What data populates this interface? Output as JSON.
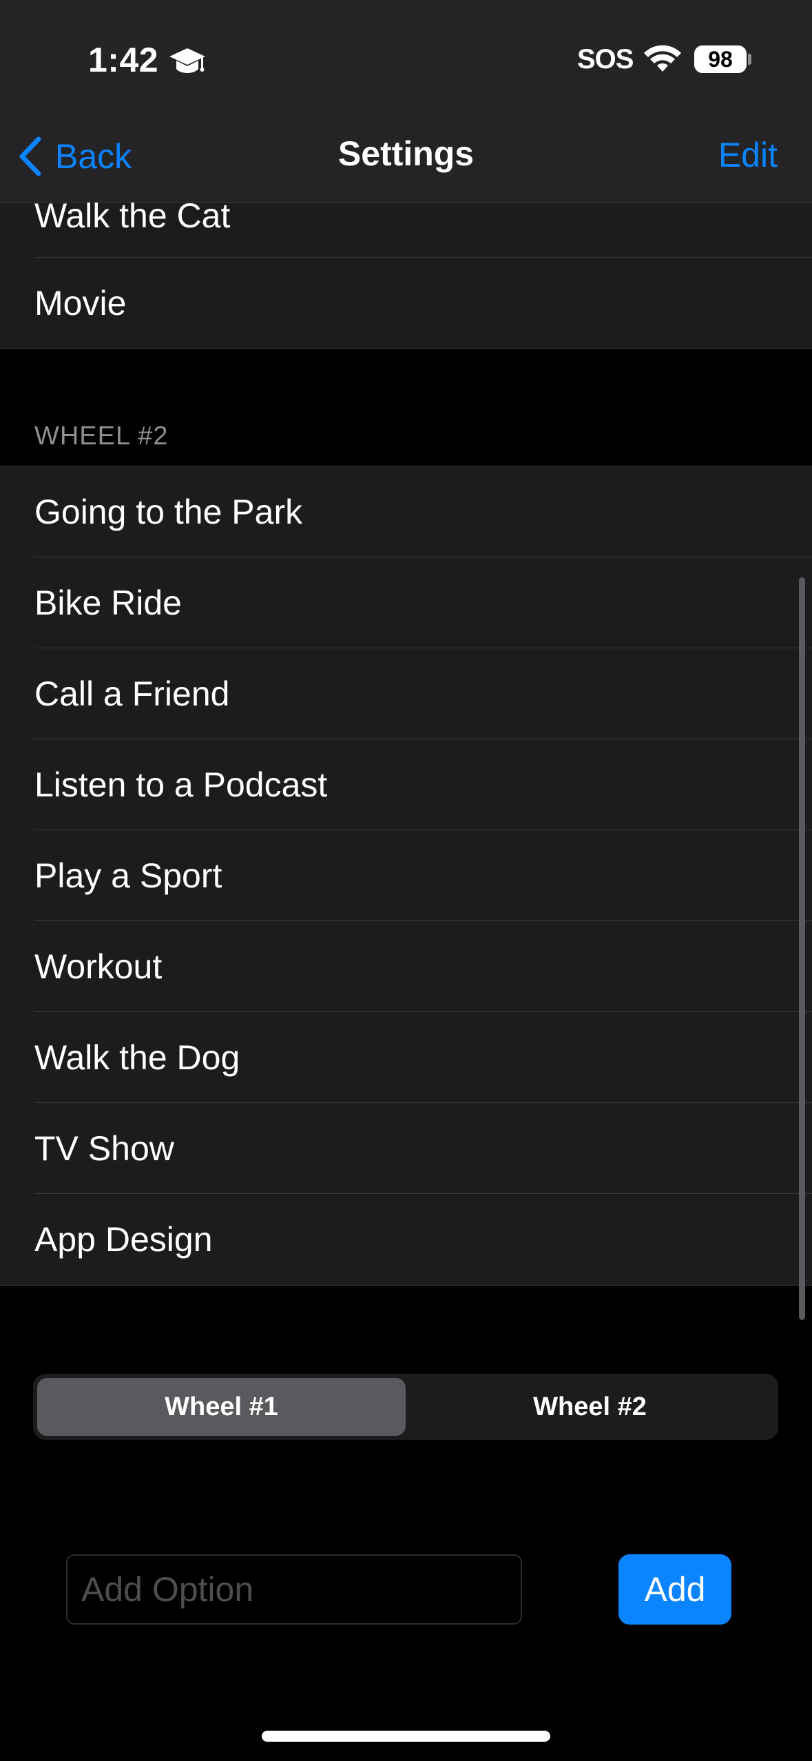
{
  "status_bar": {
    "time": "1:42",
    "carrier": "SOS",
    "battery": "98",
    "icons": [
      "graduation-cap-icon",
      "wifi-icon",
      "battery-icon"
    ]
  },
  "nav": {
    "back_label": "Back",
    "title": "Settings",
    "edit_label": "Edit"
  },
  "wheel1_items": [
    "Walk the Cat",
    "Movie"
  ],
  "wheel2": {
    "header": "WHEEL #2",
    "items": [
      "Going to the Park",
      "Bike Ride",
      "Call a Friend",
      "Listen to a Podcast",
      "Play a Sport",
      "Workout",
      "Walk the Dog",
      "TV Show",
      "App Design"
    ]
  },
  "segmented": {
    "options": [
      "Wheel #1",
      "Wheel #2"
    ],
    "selected": "Wheel #1"
  },
  "add_option": {
    "placeholder": "Add Option",
    "value": "",
    "button_label": "Add"
  },
  "colors": {
    "accent": "#0a84ff",
    "background": "#000000",
    "cell": "#1c1c1e",
    "header": "#242426"
  }
}
